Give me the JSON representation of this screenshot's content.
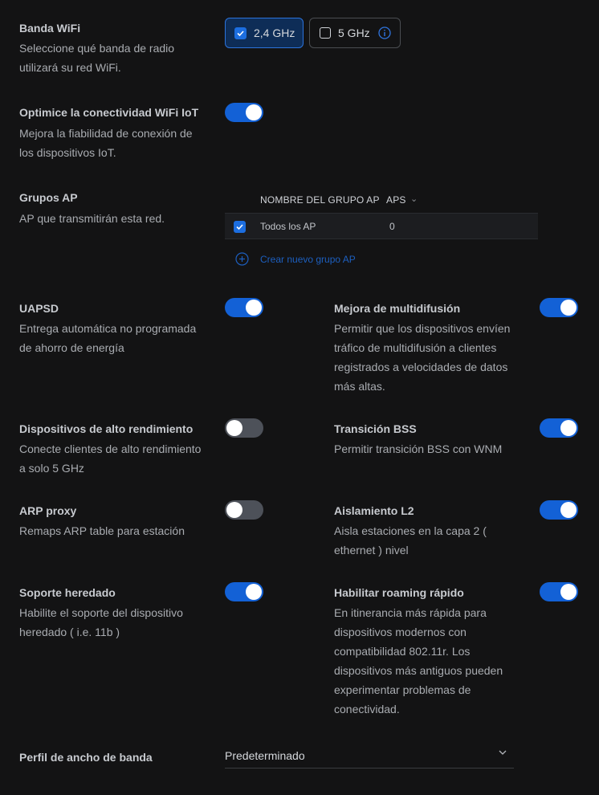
{
  "wifi_band": {
    "title": "Banda WiFi",
    "description": "Seleccione qué banda de radio utilizará su red WiFi.",
    "options": [
      {
        "label": "2,4 GHz",
        "checked": true
      },
      {
        "label": "5 GHz",
        "checked": false
      }
    ],
    "info_icon": "info-icon"
  },
  "iot": {
    "title": "Optimice la conectividad WiFi IoT",
    "description": "Mejora la fiabilidad de conexión de los dispositivos IoT.",
    "enabled": true
  },
  "ap_groups": {
    "title": "Grupos AP",
    "description": "AP que transmitirán esta red.",
    "columns": [
      "NOMBRE DEL GRUPO AP",
      "APS"
    ],
    "rows": [
      {
        "name": "Todos los AP",
        "aps": "0",
        "checked": true
      }
    ],
    "create_label": "Crear nuevo grupo AP"
  },
  "uapsd": {
    "title": "UAPSD",
    "description": "Entrega automática no programada de ahorro de energía",
    "enabled": true
  },
  "multicast": {
    "title": "Mejora de multidifusión",
    "description": "Permitir que los dispositivos envíen tráfico de multidifusión a clientes registrados a velocidades de datos más altas.",
    "enabled": true
  },
  "high_perf": {
    "title": "Dispositivos de alto rendimiento",
    "description": "Conecte clientes de alto rendimiento a solo 5 GHz",
    "enabled": false
  },
  "bss": {
    "title": "Transición BSS",
    "description": "Permitir transición BSS con WNM",
    "enabled": true
  },
  "arp": {
    "title": "ARP proxy",
    "description": "Remaps ARP table para estación",
    "enabled": false
  },
  "l2": {
    "title": "Aislamiento L2",
    "description": "Aisla estaciones en la capa 2 ( ethernet ) nivel",
    "enabled": true
  },
  "legacy": {
    "title": "Soporte heredado",
    "description": "Habilite el soporte del dispositivo heredado ( i.e. 11b )",
    "enabled": true
  },
  "fast_roaming": {
    "title": "Habilitar roaming rápido",
    "description": "En itinerancia más rápida para dispositivos modernos con compatibilidad 802.11r. Los dispositivos más antiguos pueden experimentar problemas de conectividad.",
    "enabled": true
  },
  "bandwidth_profile": {
    "title": "Perfil de ancho de banda",
    "value": "Predeterminado"
  },
  "colors": {
    "accent": "#1361d6",
    "background": "#131314",
    "toggle_off": "#4d5159"
  }
}
